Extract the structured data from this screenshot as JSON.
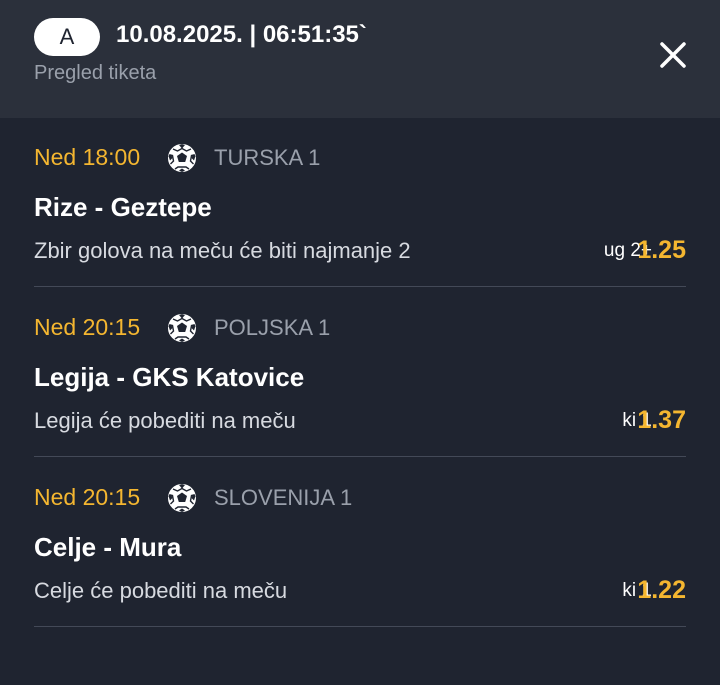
{
  "header": {
    "badge": "A",
    "datetime": "10.08.2025. | 06:51:35`",
    "subtitle": "Pregled tiketa"
  },
  "colors": {
    "header_bg": "#2b303b",
    "content_bg": "#1f2430",
    "accent": "#f4b630",
    "muted": "#9aa0ab"
  },
  "matches": [
    {
      "time": "Ned 18:00",
      "sport_icon": "soccer-ball-icon",
      "league": "TURSKA 1",
      "teams": "Rize - Geztepe",
      "description": "Zbir golova na meču će biti najmanje 2",
      "bet": "ug 2+",
      "odd": "1.25"
    },
    {
      "time": "Ned 20:15",
      "sport_icon": "soccer-ball-icon",
      "league": "POLJSKA 1",
      "teams": "Legija - GKS Katovice",
      "description": "Legija će pobediti na meču",
      "bet": "ki 1",
      "odd": "1.37"
    },
    {
      "time": "Ned 20:15",
      "sport_icon": "soccer-ball-icon",
      "league": "SLOVENIJA 1",
      "teams": "Celje - Mura",
      "description": "Celje će pobediti na meču",
      "bet": "ki 1",
      "odd": "1.22"
    }
  ]
}
